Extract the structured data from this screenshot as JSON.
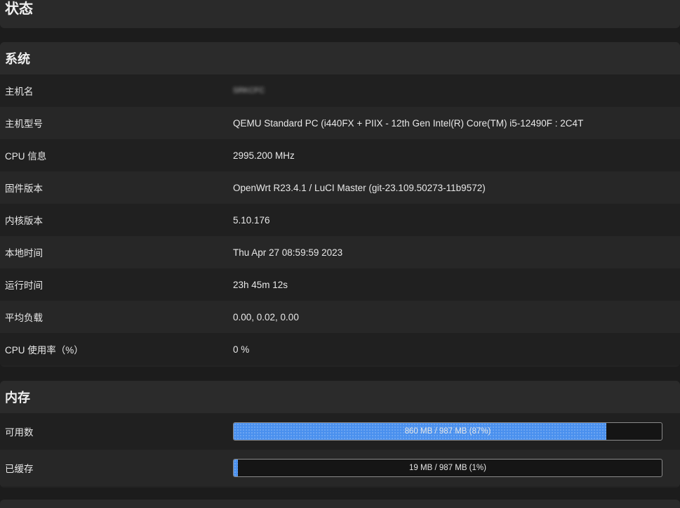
{
  "page_title": "状态",
  "system": {
    "title": "系统",
    "rows": [
      {
        "label": "主机名",
        "value": "SRKCFC"
      },
      {
        "label": "主机型号",
        "value": "QEMU Standard PC (i440FX + PIIX - 12th Gen Intel(R) Core(TM) i5-12490F : 2C4T"
      },
      {
        "label": "CPU 信息",
        "value": "2995.200 MHz"
      },
      {
        "label": "固件版本",
        "value": "OpenWrt R23.4.1 / LuCI Master (git-23.109.50273-11b9572)"
      },
      {
        "label": "内核版本",
        "value": "5.10.176"
      },
      {
        "label": "本地时间",
        "value": "Thu Apr 27 08:59:59 2023"
      },
      {
        "label": "运行时间",
        "value": "23h 45m 12s"
      },
      {
        "label": "平均负载",
        "value": "0.00, 0.02, 0.00"
      },
      {
        "label": "CPU 使用率（%）",
        "value": "0 %"
      }
    ]
  },
  "memory": {
    "title": "内存",
    "rows": [
      {
        "label": "可用数",
        "text": "860 MB / 987 MB (87%)",
        "percent": 87
      },
      {
        "label": "已缓存",
        "text": "19 MB / 987 MB (1%)",
        "percent": 1
      }
    ]
  },
  "colors": {
    "bar_fill": "#4a90ee",
    "background": "#1c1c1c"
  }
}
